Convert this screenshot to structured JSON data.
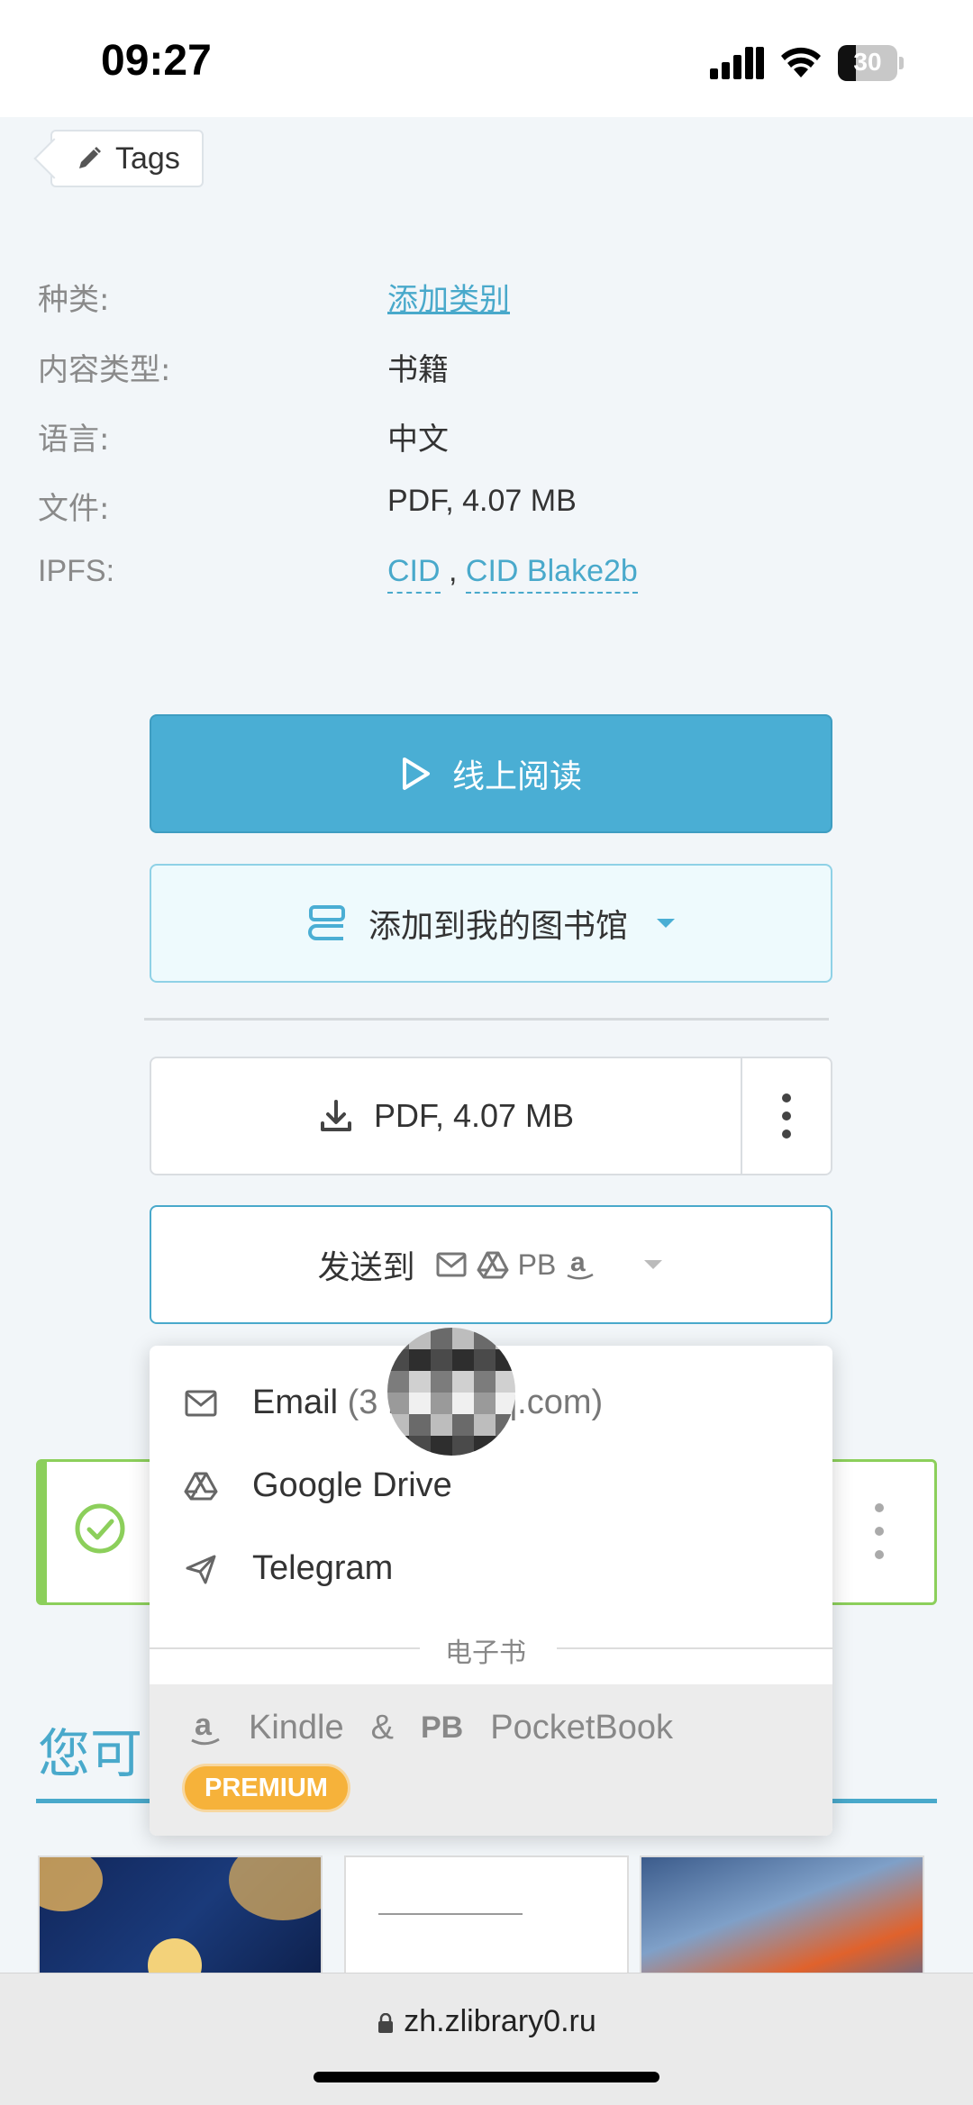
{
  "status_bar": {
    "time": "09:27",
    "battery": "30",
    "battery_level": 0.3
  },
  "tags": {
    "label": "Tags"
  },
  "details": {
    "category": {
      "key": "种类:",
      "value": "添加类别"
    },
    "content_type": {
      "key": "内容类型:",
      "value": "书籍"
    },
    "language": {
      "key": "语言:",
      "value": "中文"
    },
    "file": {
      "key": "文件:",
      "value": "PDF, 4.07 MB"
    },
    "ipfs": {
      "key": "IPFS:",
      "cid": "CID",
      "separator": ",",
      "cid_blake": "CID Blake2b"
    }
  },
  "buttons": {
    "read_online": "线上阅读",
    "add_to_library": "添加到我的图书馆",
    "download": "PDF, 4.07 MB",
    "send_to": "发送到",
    "send_pb": "PB"
  },
  "dropdown": {
    "email_label": "Email",
    "email_address": "(3        184@qq.com)",
    "google_drive": "Google Drive",
    "telegram": "Telegram",
    "ebook_section": "电子书",
    "kindle": "Kindle",
    "ampersand": "&",
    "pb_mark": "PB",
    "pocketbook": "PocketBook",
    "premium_badge": "PREMIUM"
  },
  "recommend": {
    "title": "您可"
  },
  "browser": {
    "url": "zh.zlibrary0.ru"
  },
  "colors": {
    "accent": "#49a9cb",
    "success": "#8ccf5b",
    "premium": "#f6b23a"
  }
}
